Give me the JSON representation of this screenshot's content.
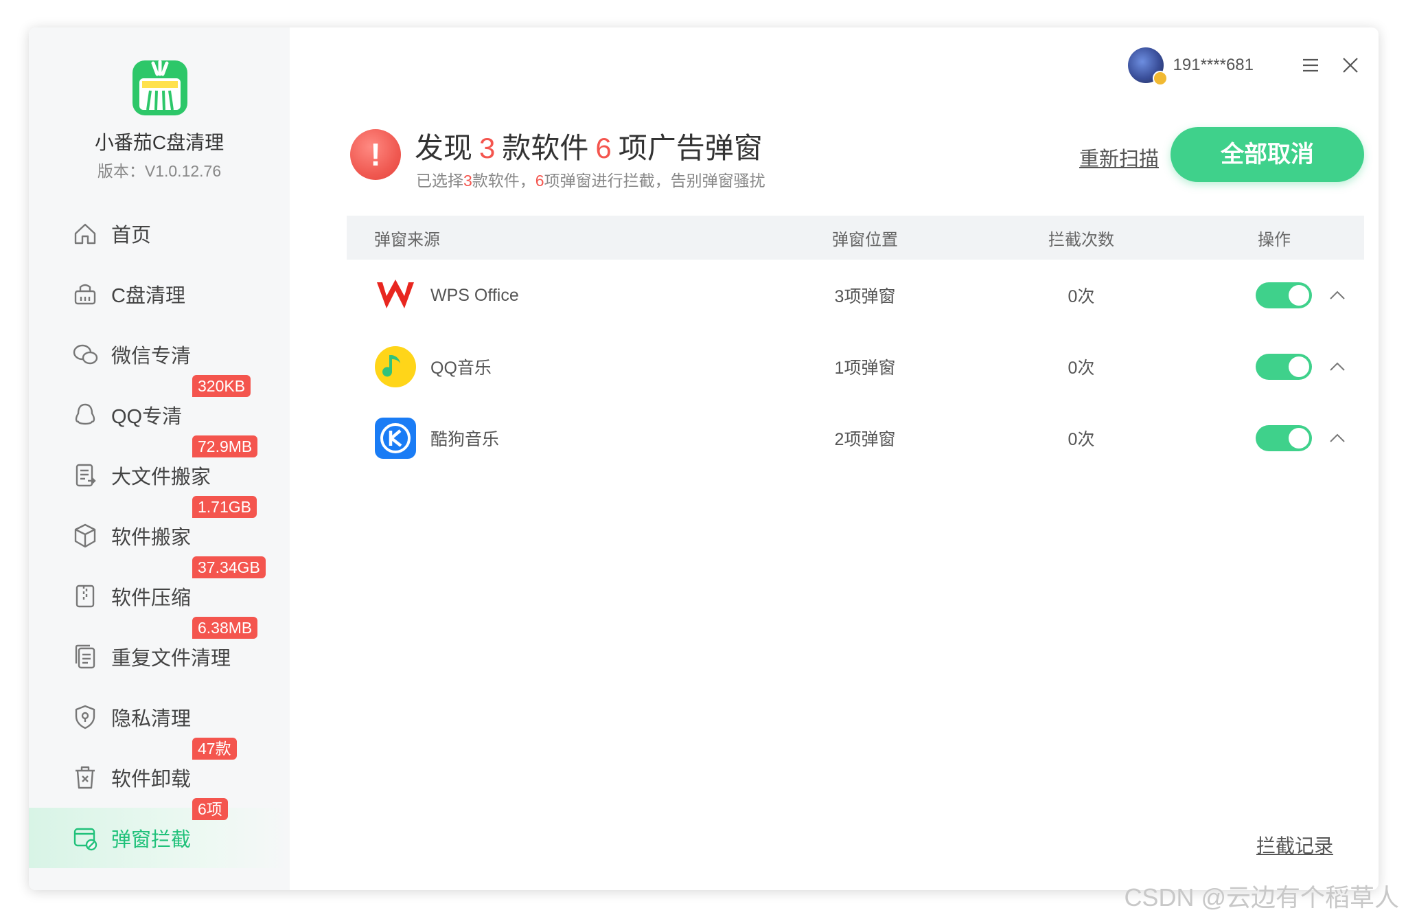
{
  "app": {
    "name": "小番茄C盘清理",
    "version": "版本：V1.0.12.76"
  },
  "nav": [
    {
      "label": "首页",
      "icon": "home-icon",
      "badge": ""
    },
    {
      "label": "C盘清理",
      "icon": "basket-icon",
      "badge": ""
    },
    {
      "label": "微信专清",
      "icon": "wechat-icon",
      "badge": ""
    },
    {
      "label": "QQ专清",
      "icon": "qq-icon",
      "badge": "320KB"
    },
    {
      "label": "大文件搬家",
      "icon": "file-move-icon",
      "badge": "72.9MB"
    },
    {
      "label": "软件搬家",
      "icon": "box-icon",
      "badge": "1.71GB"
    },
    {
      "label": "软件压缩",
      "icon": "zip-file-icon",
      "badge": "37.34GB"
    },
    {
      "label": "重复文件清理",
      "icon": "duplicate-file-icon",
      "badge": "6.38MB"
    },
    {
      "label": "隐私清理",
      "icon": "shield-icon",
      "badge": ""
    },
    {
      "label": "软件卸载",
      "icon": "uninstall-icon",
      "badge": "47款"
    },
    {
      "label": "弹窗拦截",
      "icon": "popup-block-icon",
      "badge": "6项"
    }
  ],
  "user": {
    "phone": "191****681"
  },
  "header": {
    "prefix": "发现",
    "software_count": "3",
    "middle": "款软件",
    "popup_count": "6",
    "suffix": "项广告弹窗",
    "sub_prefix": "已选择",
    "sub_software_count": "3",
    "sub_middle": "款软件，",
    "sub_popup_count": "6",
    "sub_suffix": "项弹窗进行拦截，告别弹窗骚扰",
    "rescan": "重新扫描",
    "cancel_all": "全部取消"
  },
  "table": {
    "headers": [
      "弹窗来源",
      "弹窗位置",
      "拦截次数",
      "操作"
    ],
    "rows": [
      {
        "name": "WPS Office",
        "icon": "wps-icon",
        "position": "3项弹窗",
        "count": "0次",
        "enabled": true
      },
      {
        "name": "QQ音乐",
        "icon": "qq-music-icon",
        "position": "1项弹窗",
        "count": "0次",
        "enabled": true
      },
      {
        "name": "酷狗音乐",
        "icon": "kugou-icon",
        "position": "2项弹窗",
        "count": "0次",
        "enabled": true
      }
    ]
  },
  "footer": {
    "records": "拦截记录"
  },
  "watermark": "CSDN @云边有个稻草人",
  "colors": {
    "accent": "#3fd18b",
    "badge": "#f4554e",
    "active_nav": "#20c17a"
  }
}
